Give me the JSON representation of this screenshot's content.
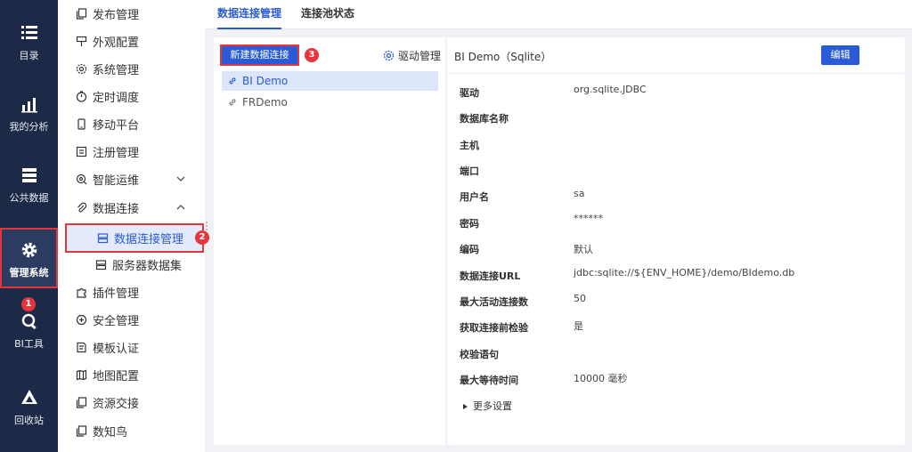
{
  "leftnav": {
    "items": [
      {
        "label": "目录",
        "icon": "list-icon"
      },
      {
        "label": "我的分析",
        "icon": "chart-icon"
      },
      {
        "label": "公共数据",
        "icon": "server-icon"
      },
      {
        "label": "管理系统",
        "icon": "gear-icon",
        "badge": "1"
      },
      {
        "label": "BI工具",
        "icon": "tool-icon"
      },
      {
        "label": "回收站",
        "icon": "recycle-icon"
      }
    ]
  },
  "submenu": {
    "items": [
      {
        "label": "发布管理",
        "icon": "copy-icon"
      },
      {
        "label": "外观配置",
        "icon": "brush-icon"
      },
      {
        "label": "系统管理",
        "icon": "cog-icon"
      },
      {
        "label": "定时调度",
        "icon": "timer-icon"
      },
      {
        "label": "移动平台",
        "icon": "phone-icon"
      },
      {
        "label": "注册管理",
        "icon": "register-icon"
      },
      {
        "label": "智能运维",
        "icon": "ops-icon"
      },
      {
        "label": "数据连接",
        "icon": "paperclip-icon"
      },
      {
        "label": "数据连接管理",
        "icon": "db-icon",
        "badge": "2"
      },
      {
        "label": "服务器数据集",
        "icon": "db-icon"
      },
      {
        "label": "插件管理",
        "icon": "puzzle-icon"
      },
      {
        "label": "安全管理",
        "icon": "shield-icon"
      },
      {
        "label": "模板认证",
        "icon": "template-icon"
      },
      {
        "label": "地图配置",
        "icon": "map-icon"
      },
      {
        "label": "资源交接",
        "icon": "copy-icon"
      },
      {
        "label": "数知鸟",
        "icon": "copy-icon"
      }
    ]
  },
  "tabs": [
    {
      "label": "数据连接管理"
    },
    {
      "label": "连接池状态"
    }
  ],
  "left": {
    "new_button": "新建数据连接",
    "new_badge": "3",
    "driver_manage": "驱动管理",
    "connections": [
      "BI Demo",
      "FRDemo"
    ]
  },
  "detail": {
    "title": "BI Demo（Sqlite）",
    "edit_button": "编辑",
    "fields": [
      {
        "key": "驱动",
        "value": "org.sqlite.JDBC"
      },
      {
        "key": "数据库名称",
        "value": ""
      },
      {
        "key": "主机",
        "value": ""
      },
      {
        "key": "端口",
        "value": ""
      },
      {
        "key": "用户名",
        "value": "sa"
      },
      {
        "key": "密码",
        "value": "******"
      },
      {
        "key": "编码",
        "value": "默认"
      },
      {
        "key": "数据连接URL",
        "value": "jdbc:sqlite://${ENV_HOME}/demo/BIdemo.db"
      },
      {
        "key": "最大活动连接数",
        "value": "50"
      },
      {
        "key": "获取连接前检验",
        "value": "是"
      },
      {
        "key": "校验语句",
        "value": ""
      },
      {
        "key": "最大等待时间",
        "value": "10000 毫秒"
      }
    ],
    "more": "更多设置"
  },
  "colors": {
    "accent": "#2a5bd7",
    "nav_bg": "#1c2a48",
    "highlight": "#e8343b"
  }
}
